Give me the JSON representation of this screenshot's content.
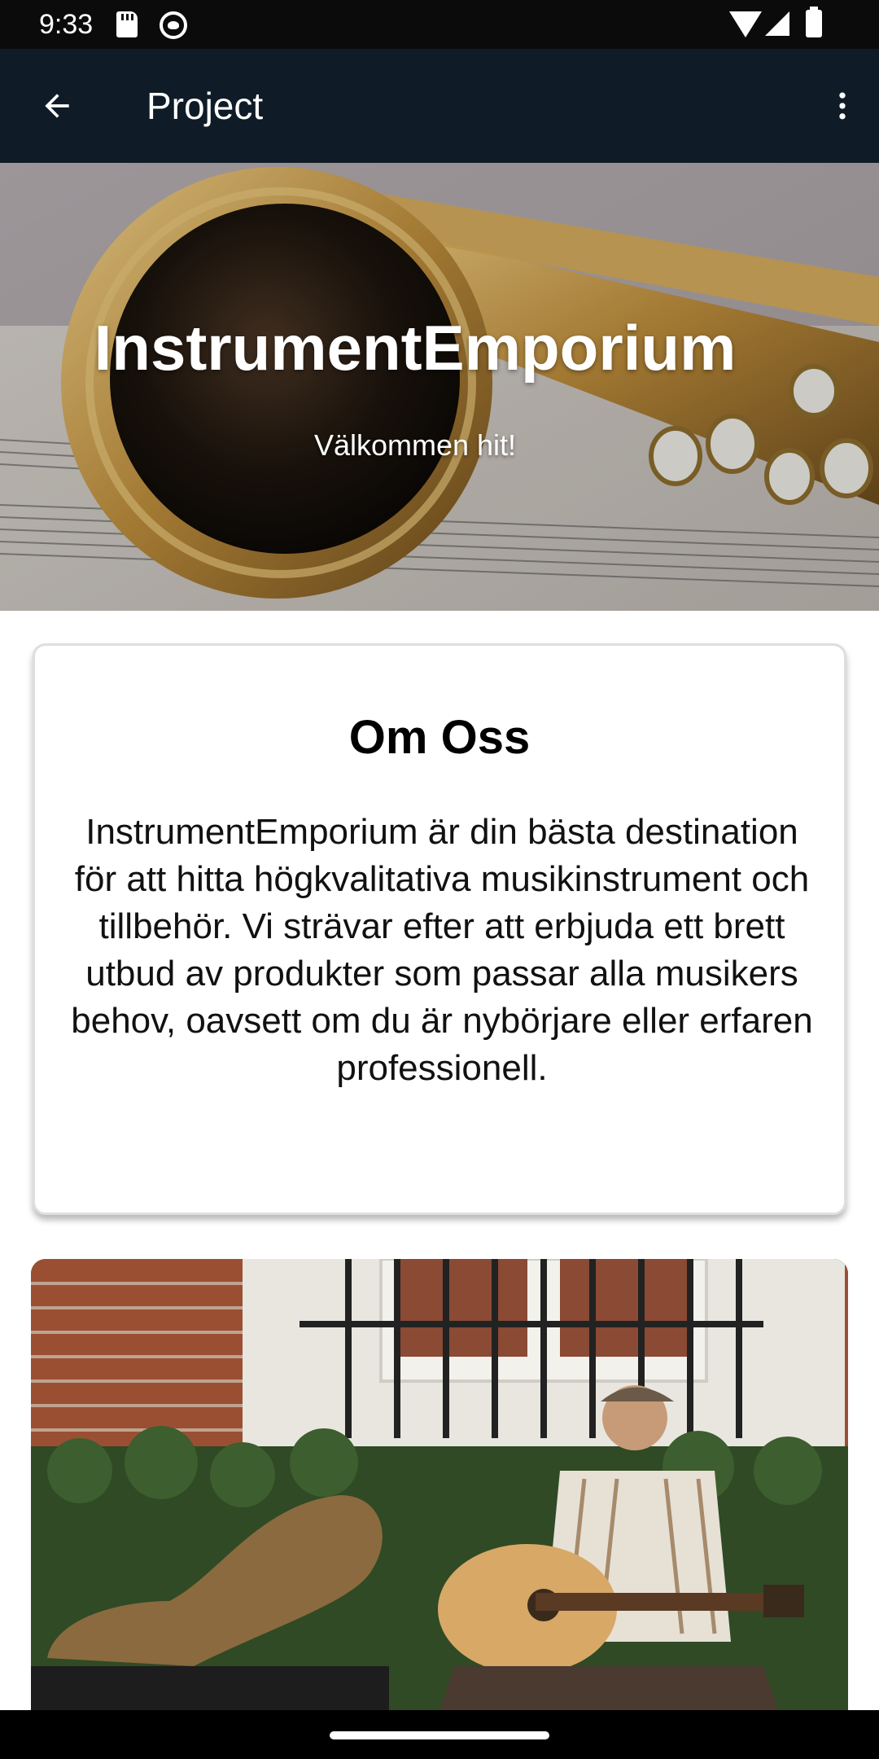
{
  "status_bar": {
    "time": "9:33",
    "icons": [
      "sd-card-icon",
      "cat-icon",
      "wifi-icon",
      "cell-signal-icon",
      "battery-icon"
    ]
  },
  "app_bar": {
    "title": "Project",
    "back_icon": "arrow-left-icon",
    "menu_icon": "more-vertical-icon",
    "background": "#0f1c27"
  },
  "hero": {
    "title": "InstrumentEmporium",
    "subtitle": "Välkommen hit!",
    "image": "saxophone-on-sheet-music"
  },
  "about": {
    "title": "Om Oss",
    "body": "InstrumentEmporium är din bästa destination för att hitta högkvalitativa musikinstrument och tillbehör. Vi strävar efter att erbjuda ett brett utbud av produkter som passar alla musikers behov, oavsett om du är nybörjare eller erfaren professionell."
  },
  "musician_image": {
    "image": "guitarist-sitting-on-street"
  },
  "nav_bar": {
    "handle": "home-gesture-handle"
  }
}
